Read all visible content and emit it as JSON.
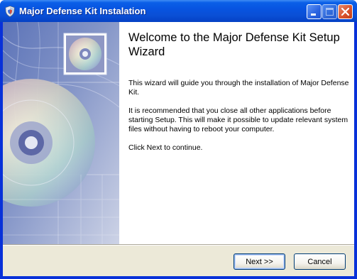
{
  "window": {
    "title": "Major Defense Kit Instalation"
  },
  "wizard": {
    "heading": "Welcome to the Major Defense Kit Setup Wizard",
    "paragraphs": [
      "This wizard will guide you through the installation of Major Defense Kit.",
      "It is recommended that you close all other applications before starting Setup. This will make it possible to update relevant system files without having to reboot your computer.",
      "Click Next to continue."
    ]
  },
  "buttons": {
    "next": "Next >>",
    "cancel": "Cancel"
  },
  "icons": {
    "app": "shield-icon",
    "minimize": "minimize-icon",
    "maximize": "maximize-icon",
    "close": "close-icon",
    "banner": "cd-disc-icon"
  },
  "colors": {
    "titlebar": "#0a54e0",
    "close_button": "#d9532d",
    "panel_bg": "#ece9d8"
  }
}
